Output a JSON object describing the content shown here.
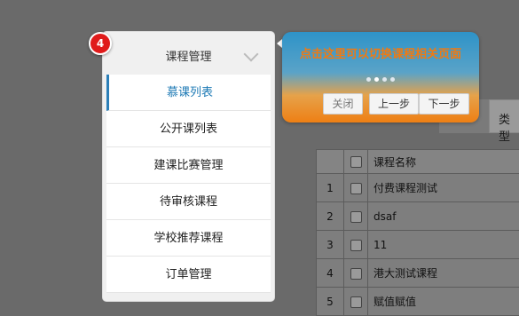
{
  "menu": {
    "title": "课程管理",
    "items": [
      {
        "label": "慕课列表",
        "active": true
      },
      {
        "label": "公开课列表"
      },
      {
        "label": "建课比赛管理"
      },
      {
        "label": "待审核课程"
      },
      {
        "label": "学校推荐课程"
      },
      {
        "label": "订单管理"
      }
    ]
  },
  "tour": {
    "step": "4",
    "message": "点击这里可以切换课程相关页面",
    "close_label": "关闭",
    "prev_label": "上一步",
    "next_label": "下一步",
    "total_dots": 4,
    "active_dot": 1
  },
  "background": {
    "type_label": "类型",
    "table": {
      "header": "课程名称",
      "rows": [
        {
          "num": "1",
          "name": "付费课程测试"
        },
        {
          "num": "2",
          "name": "dsaf"
        },
        {
          "num": "3",
          "name": "11"
        },
        {
          "num": "4",
          "name": "港大测试课程"
        },
        {
          "num": "5",
          "name": "赋值赋值"
        }
      ]
    }
  },
  "colors": {
    "badge": "#e01b1b",
    "active_link": "#1e7ab5",
    "popover_top": "#2e93c8",
    "popover_bottom": "#ee7f14"
  }
}
